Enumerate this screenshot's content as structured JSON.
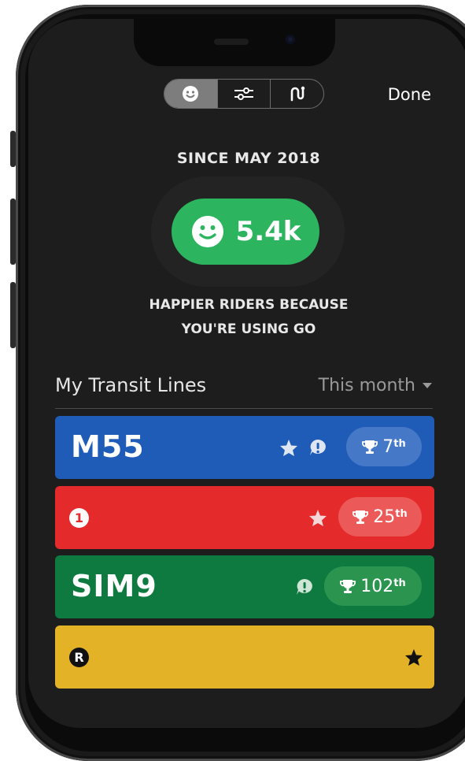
{
  "toolbar": {
    "segments": [
      "smiley",
      "sliders",
      "route"
    ],
    "active_segment": 0,
    "done_label": "Done"
  },
  "stats": {
    "since_label": "SINCE MAY 2018",
    "happy_count": "5.4k",
    "caption_line1": "HAPPIER RIDERS BECAUSE",
    "caption_line2": "YOU'RE USING GO",
    "accent": "#2cb45f"
  },
  "lines_section": {
    "title": "My Transit Lines",
    "period": "This month"
  },
  "lines": [
    {
      "name": "M55",
      "color": "#1f5cb8",
      "badge_color": "#4579c8",
      "starred": true,
      "alert": true,
      "rank": "7",
      "rank_suffix": "th"
    },
    {
      "name": "1",
      "bullet": true,
      "color": "#e42a2a",
      "badge_color": "#ec5959",
      "starred": true,
      "alert": false,
      "rank": "25",
      "rank_suffix": "th"
    },
    {
      "name": "SIM9",
      "color": "#0f7a3f",
      "badge_color": "#2b944f",
      "starred": false,
      "alert": true,
      "rank": "102",
      "rank_suffix": "th"
    },
    {
      "name": "R",
      "bullet": true,
      "color": "#e3b226",
      "starred": true,
      "alert": false
    }
  ]
}
